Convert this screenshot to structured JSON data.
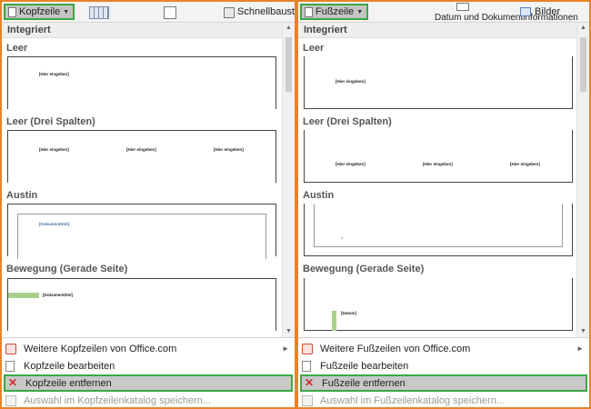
{
  "header_panel": {
    "ribbon": {
      "main_button_label": "Kopfzeile",
      "quick_parts_label": "Schnellbausteine"
    },
    "section_label": "Integriert",
    "items": [
      {
        "title": "Leer",
        "placeholders": [
          "[Hier eingeben]"
        ]
      },
      {
        "title": "Leer (Drei Spalten)",
        "placeholders": [
          "[Hier eingeben]",
          "[Hier eingeben]",
          "[Hier eingeben]"
        ]
      },
      {
        "title": "Austin",
        "placeholders": [
          "[Dokumenttitel]"
        ]
      },
      {
        "title": "Bewegung (Gerade Seite)",
        "placeholders": [
          "[Dokumenttitel]"
        ]
      }
    ],
    "menu": [
      {
        "label": "Weitere Kopfzeilen von Office.com",
        "state": "normal",
        "submenu": true
      },
      {
        "label": "Kopfzeile bearbeiten",
        "state": "normal",
        "submenu": false
      },
      {
        "label": "Kopfzeile entfernen",
        "state": "selected",
        "submenu": false
      },
      {
        "label": "Auswahl im Kopfzeilenkatalog speichern...",
        "state": "disabled",
        "submenu": false
      }
    ]
  },
  "footer_panel": {
    "ribbon": {
      "main_button_label": "Fußzeile",
      "doc_info_label": "Datum und Dokumentinformationen",
      "pictures_label": "Bilder"
    },
    "section_label": "Integriert",
    "items": [
      {
        "title": "Leer",
        "placeholders": [
          "[Hier eingeben]"
        ]
      },
      {
        "title": "Leer (Drei Spalten)",
        "placeholders": [
          "[Hier eingeben]",
          "[Hier eingeben]",
          "[Hier eingeben]"
        ]
      },
      {
        "title": "Austin",
        "placeholders": [
          "1"
        ]
      },
      {
        "title": "Bewegung (Gerade Seite)",
        "placeholders": [
          "[Datum]"
        ]
      }
    ],
    "menu": [
      {
        "label": "Weitere Fußzeilen von Office.com",
        "state": "normal",
        "submenu": true
      },
      {
        "label": "Fußzeile bearbeiten",
        "state": "normal",
        "submenu": false
      },
      {
        "label": "Fußzeile entfernen",
        "state": "selected",
        "submenu": false
      },
      {
        "label": "Auswahl im Fußzeilenkatalog speichern...",
        "state": "disabled",
        "submenu": false
      }
    ]
  },
  "colors": {
    "panel_border": "#e8832a",
    "highlight_border": "#3aa845",
    "selected_background": "#c8c8c8",
    "placeholder_accent": "#a8d08d"
  }
}
